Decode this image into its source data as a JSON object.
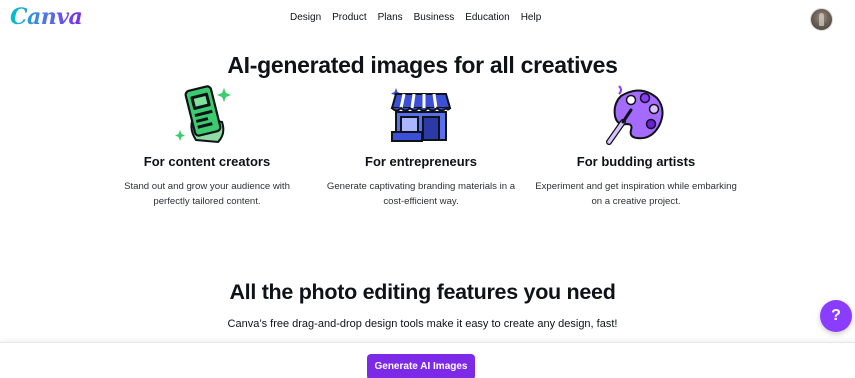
{
  "header": {
    "logo_text": "Canva",
    "nav": [
      {
        "label": "Design"
      },
      {
        "label": "Product"
      },
      {
        "label": "Plans"
      },
      {
        "label": "Business"
      },
      {
        "label": "Education"
      },
      {
        "label": "Help"
      }
    ],
    "avatar_icon": "user-avatar"
  },
  "section_ai": {
    "title": "AI-generated images for all creatives",
    "columns": [
      {
        "icon": "phone-content-icon",
        "title": "For content creators",
        "description": "Stand out and grow your audience with perfectly tailored content."
      },
      {
        "icon": "storefront-icon",
        "title": "For entrepreneurs",
        "description": "Generate captivating branding materials in a cost-efficient way."
      },
      {
        "icon": "paint-palette-icon",
        "title": "For budding artists",
        "description": "Experiment and get inspiration while embarking on a creative project."
      }
    ]
  },
  "section_features": {
    "title": "All the photo editing features you need",
    "subtitle": "Canva’s free drag-and-drop design tools make it easy to create any design, fast!"
  },
  "bottom_bar": {
    "cta_label": "Generate AI Images"
  },
  "help_fab": {
    "label": "?"
  },
  "colors": {
    "brand_purple": "#7d2ae8",
    "brand_teal": "#00c4cc",
    "text_dark": "#0e1318",
    "icon_green": "#3ccb6f",
    "icon_blue": "#3b4fd8",
    "icon_violet": "#8b3dff"
  }
}
